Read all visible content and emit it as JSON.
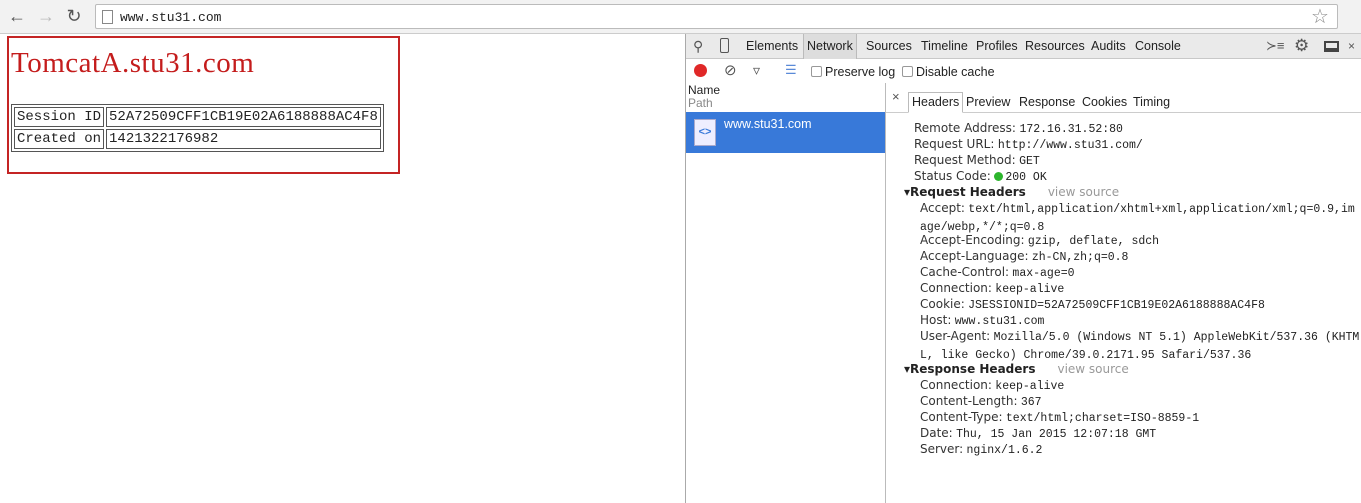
{
  "browser": {
    "url": "www.stu31.com"
  },
  "page": {
    "title": "TomcatA.stu31.com",
    "rows": [
      {
        "label": "Session ID",
        "value": "52A72509CFF1CB19E02A6188888AC4F8"
      },
      {
        "label": "Created on",
        "value": "1421322176982"
      }
    ]
  },
  "devtools": {
    "tabs": [
      "Elements",
      "Network",
      "Sources",
      "Timeline",
      "Profiles",
      "Resources",
      "Audits",
      "Console"
    ],
    "active_tab": "Network",
    "preserve_log": "Preserve log",
    "disable_cache": "Disable cache",
    "list_header": {
      "name": "Name",
      "path": "Path"
    },
    "requests": [
      {
        "name": "www.stu31.com"
      }
    ],
    "detail_tabs": [
      "Headers",
      "Preview",
      "Response",
      "Cookies",
      "Timing"
    ],
    "general": [
      {
        "k": "Remote Address:",
        "v": "172.16.31.52:80"
      },
      {
        "k": "Request URL:",
        "v": "http://www.stu31.com/"
      },
      {
        "k": "Request Method:",
        "v": "GET"
      },
      {
        "k": "Status Code:",
        "v": "200 OK",
        "status_color": "#2db52d"
      }
    ],
    "view_source": "view source",
    "request_headers_title": "Request Headers",
    "request_headers": [
      {
        "k": "Accept:",
        "v": "text/html,application/xhtml+xml,application/xml;q=0.9,image/webp,*/*;q=0.8"
      },
      {
        "k": "Accept-Encoding:",
        "v": "gzip, deflate, sdch"
      },
      {
        "k": "Accept-Language:",
        "v": "zh-CN,zh;q=0.8"
      },
      {
        "k": "Cache-Control:",
        "v": "max-age=0"
      },
      {
        "k": "Connection:",
        "v": "keep-alive"
      },
      {
        "k": "Cookie:",
        "v": "JSESSIONID=52A72509CFF1CB19E02A6188888AC4F8"
      },
      {
        "k": "Host:",
        "v": "www.stu31.com"
      },
      {
        "k": "User-Agent:",
        "v": "Mozilla/5.0 (Windows NT 5.1) AppleWebKit/537.36 (KHTML, like Gecko) Chrome/39.0.2171.95 Safari/537.36"
      }
    ],
    "response_headers_title": "Response Headers",
    "response_headers": [
      {
        "k": "Connection:",
        "v": "keep-alive"
      },
      {
        "k": "Content-Length:",
        "v": "367"
      },
      {
        "k": "Content-Type:",
        "v": "text/html;charset=ISO-8859-1"
      },
      {
        "k": "Date:",
        "v": "Thu, 15 Jan 2015 12:07:18 GMT"
      },
      {
        "k": "Server:",
        "v": "nginx/1.6.2"
      }
    ]
  }
}
